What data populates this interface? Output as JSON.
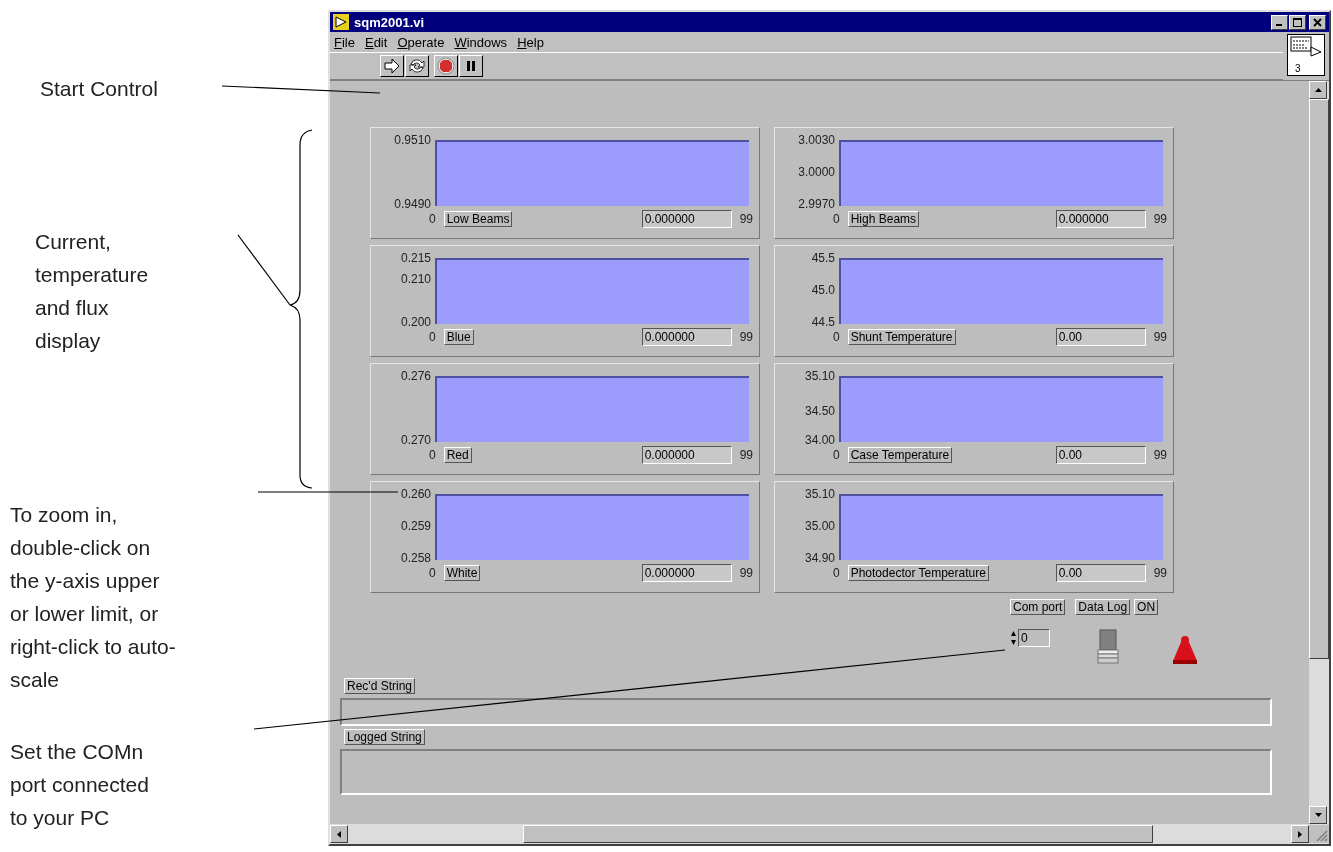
{
  "annotations": [
    {
      "text": "Start Control"
    },
    {
      "text": "Current, temperature and flux display"
    },
    {
      "text": "To zoom in, double-click on the y-axis upper or lower limit, or right-click to auto-scale"
    },
    {
      "text": "Set the COMn port connected to your PC"
    }
  ],
  "window": {
    "title": "sqm2001.vi"
  },
  "menu": [
    "File",
    "Edit",
    "Operate",
    "Windows",
    "Help"
  ],
  "icon_pane": {
    "label": "3"
  },
  "panels": [
    {
      "name": "Low Beams",
      "value": "0.000000",
      "yticks": [
        "0.9510",
        "0.9490"
      ],
      "xticks": [
        "0",
        "99"
      ]
    },
    {
      "name": "High Beams",
      "value": "0.000000",
      "yticks": [
        "3.0030",
        "3.0000",
        "2.9970"
      ],
      "xticks": [
        "0",
        "99"
      ]
    },
    {
      "name": "Blue",
      "value": "0.000000",
      "yticks": [
        "0.215",
        "0.210",
        "0.200"
      ],
      "xticks": [
        "0",
        "99"
      ]
    },
    {
      "name": "Shunt Temperature",
      "value": "0.00",
      "yticks": [
        "45.5",
        "45.0",
        "44.5"
      ],
      "xticks": [
        "0",
        "99"
      ]
    },
    {
      "name": "Red",
      "value": "0.000000",
      "yticks": [
        "0.276",
        "0.270"
      ],
      "xticks": [
        "0",
        "99"
      ]
    },
    {
      "name": "Case Temperature",
      "value": "0.00",
      "yticks": [
        "35.10",
        "34.50",
        "34.00"
      ],
      "xticks": [
        "0",
        "99"
      ]
    },
    {
      "name": "White",
      "value": "0.000000",
      "yticks": [
        "0.260",
        "0.259",
        "0.258"
      ],
      "xticks": [
        "0",
        "99"
      ]
    },
    {
      "name": "Photodector Temperature",
      "value": "0.00",
      "yticks": [
        "35.10",
        "35.00",
        "34.90"
      ],
      "xticks": [
        "0",
        "99"
      ]
    }
  ],
  "com_port": {
    "label": "Com port",
    "value": "0"
  },
  "data_log": {
    "label": "Data Log",
    "state_label": "ON",
    "on": false
  },
  "strings": [
    {
      "label": "Rec'd String",
      "kind": "line"
    },
    {
      "label": "Logged String",
      "kind": "box"
    }
  ]
}
